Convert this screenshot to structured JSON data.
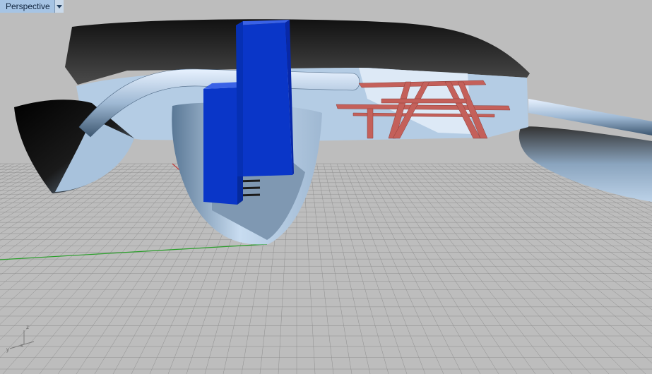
{
  "viewport": {
    "title": "Perspective",
    "menu_icon": "chevron-down-icon"
  },
  "axes": {
    "z_label": "z",
    "x_label": "x",
    "y_label": "y"
  },
  "colors": {
    "background": "#bdbdbd",
    "grid_lines": "#8f8f8f",
    "hull": "#b8cfe6",
    "deck": "#3a3a3a",
    "blue_block": "#0a36c8",
    "picnic_table": "#c4605a",
    "x_axis": "#c23b3b",
    "y_axis": "#2a9e2a"
  }
}
